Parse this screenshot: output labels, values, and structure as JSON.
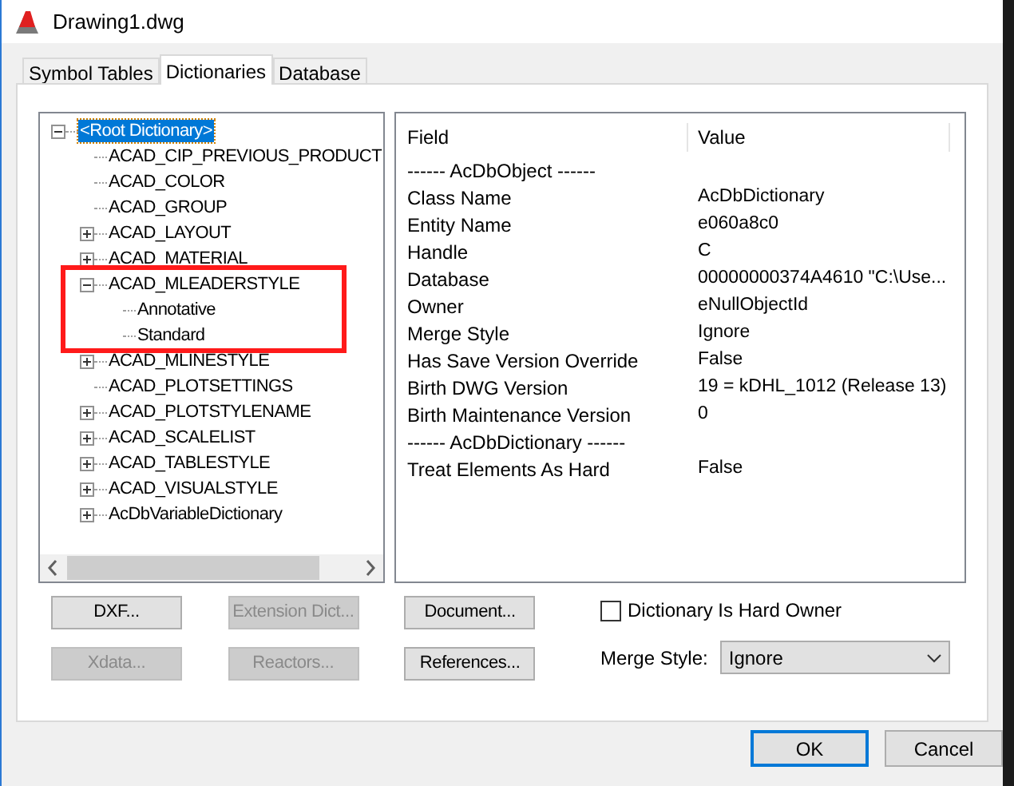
{
  "window": {
    "title": "Drawing1.dwg"
  },
  "tabs": [
    {
      "label": "Symbol Tables",
      "selected": false
    },
    {
      "label": "Dictionaries",
      "selected": true
    },
    {
      "label": "Database",
      "selected": false
    }
  ],
  "tree": [
    {
      "label": "<Root Dictionary>",
      "selected": true,
      "expanded": true,
      "children": [
        {
          "label": "ACAD_CIP_PREVIOUS_PRODUCT",
          "selected": false
        },
        {
          "label": "ACAD_COLOR",
          "selected": false
        },
        {
          "label": "ACAD_GROUP",
          "selected": false
        },
        {
          "label": "ACAD_LAYOUT",
          "selected": false,
          "expanded": false
        },
        {
          "label": "ACAD_MATERIAL",
          "selected": false,
          "expanded": false
        },
        {
          "label": "ACAD_MLEADERSTYLE",
          "selected": false,
          "expanded": true,
          "children": [
            {
              "label": "Annotative",
              "selected": false
            },
            {
              "label": "Standard",
              "selected": false
            }
          ]
        },
        {
          "label": "ACAD_MLINESTYLE",
          "selected": false,
          "expanded": false
        },
        {
          "label": "ACAD_PLOTSETTINGS",
          "selected": false
        },
        {
          "label": "ACAD_PLOTSTYLENAME",
          "selected": false,
          "expanded": false
        },
        {
          "label": "ACAD_SCALELIST",
          "selected": false,
          "expanded": false
        },
        {
          "label": "ACAD_TABLESTYLE",
          "selected": false,
          "expanded": false
        },
        {
          "label": "ACAD_VISUALSTYLE",
          "selected": false,
          "expanded": false
        },
        {
          "label": "AcDbVariableDictionary",
          "selected": false,
          "expanded": false
        }
      ]
    }
  ],
  "properties": {
    "columns": [
      "Field",
      "Value"
    ],
    "rows": [
      {
        "kind": "section",
        "field": "------ AcDbObject ------"
      },
      {
        "kind": "pair",
        "field": "Class Name",
        "value": "AcDbDictionary"
      },
      {
        "kind": "pair",
        "field": "Entity Name",
        "value": "e060a8c0"
      },
      {
        "kind": "pair",
        "field": "Handle",
        "value": "C"
      },
      {
        "kind": "pair",
        "field": "Database",
        "value": "00000000374A4610  \"C:\\Use..."
      },
      {
        "kind": "pair",
        "field": "Owner",
        "value": "eNullObjectId"
      },
      {
        "kind": "pair",
        "field": "Merge Style",
        "value": "Ignore"
      },
      {
        "kind": "pair",
        "field": "Has Save Version Override",
        "value": "False"
      },
      {
        "kind": "pair",
        "field": "Birth DWG Version",
        "value": "19 = kDHL_1012  (Release 13)"
      },
      {
        "kind": "pair",
        "field": "Birth Maintenance Version",
        "value": "0"
      },
      {
        "kind": "section",
        "field": "------ AcDbDictionary ------"
      },
      {
        "kind": "pair",
        "field": "Treat Elements As Hard",
        "value": "False"
      }
    ]
  },
  "buttons": [
    {
      "label": "DXF...",
      "disabled": false
    },
    {
      "label": "Extension Dict...",
      "disabled": true
    },
    {
      "label": "Document...",
      "disabled": false
    },
    {
      "label": "Xdata...",
      "disabled": true
    },
    {
      "label": "Reactors...",
      "disabled": true
    },
    {
      "label": "References...",
      "disabled": false
    }
  ],
  "hard_owner": {
    "label": "Dictionary Is Hard Owner",
    "checked": false
  },
  "merge_style": {
    "label": "Merge Style:",
    "value": "Ignore"
  },
  "footer_buttons": [
    {
      "label": "OK",
      "default": true
    },
    {
      "label": "Cancel",
      "default": false
    }
  ]
}
